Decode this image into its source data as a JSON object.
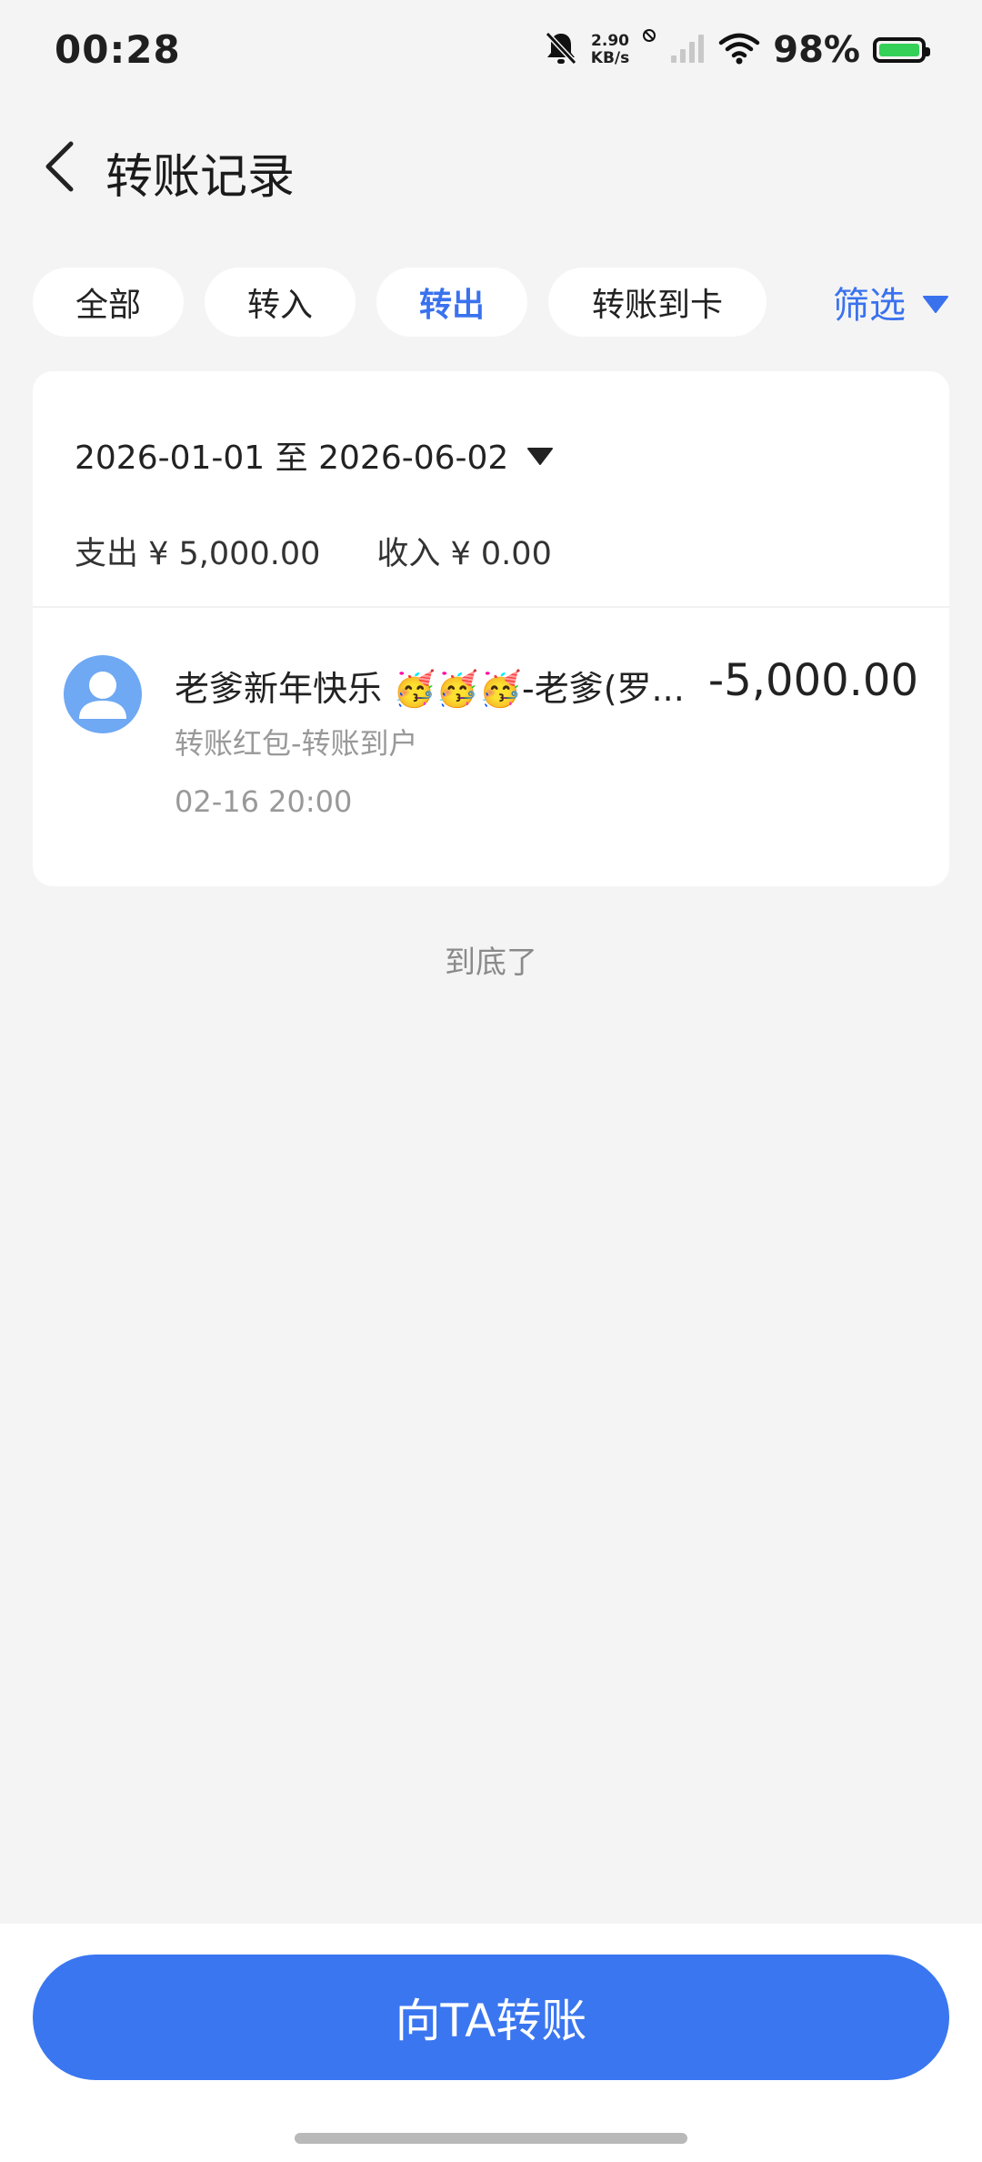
{
  "status_bar": {
    "time": "00:28",
    "net_speed_value": "2.90",
    "net_speed_unit": "KB/s",
    "battery_percent": "98%",
    "battery_level": 0.98,
    "icons": [
      "bell-muted-icon",
      "no-sim-icon",
      "signal-icon",
      "wifi-icon",
      "battery-icon"
    ]
  },
  "header": {
    "back_icon": "chevron-left-icon",
    "title": "转账记录"
  },
  "tabs": [
    {
      "label": "全部",
      "active": false
    },
    {
      "label": "转入",
      "active": false
    },
    {
      "label": "转出",
      "active": true
    },
    {
      "label": "转账到卡",
      "active": false
    }
  ],
  "filter": {
    "label": "筛选",
    "icon": "triangle-down-icon"
  },
  "summary": {
    "date_range": "2026-01-01 至 2026-06-02",
    "expense": "支出 ¥ 5,000.00",
    "income": "收入 ¥ 0.00"
  },
  "records": [
    {
      "title": "老爹新年快乐 🥳🥳🥳-老爹(罗...",
      "amount": "-5,000.00",
      "type": "转账红包-转账到户",
      "time": "02-16 20:00",
      "avatar_icon": "default-avatar-icon"
    }
  ],
  "footer_note": "到底了",
  "bottom": {
    "button_label": "向TA转账"
  },
  "colors": {
    "accent": "#3a72ee",
    "button": "#3a76f0",
    "background": "#f4f4f4",
    "battery_fill": "#34d058",
    "avatar": "#6fa8f3"
  }
}
